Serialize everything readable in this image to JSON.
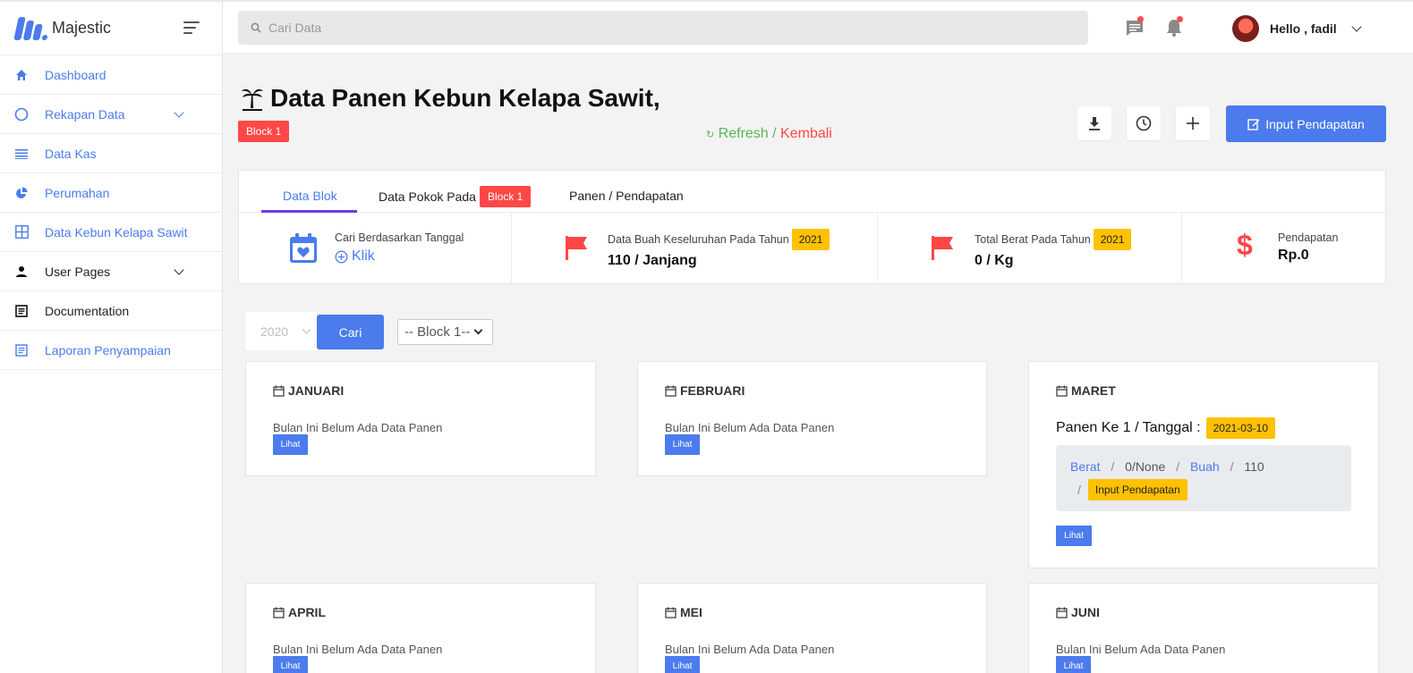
{
  "app": {
    "name": "Majestic",
    "accent": "#4b7bec",
    "danger": "#ff4747",
    "warning": "#ffc100"
  },
  "sidebar": {
    "items": [
      {
        "label": "Dashboard",
        "icon": "home-icon"
      },
      {
        "label": "Rekapan Data",
        "icon": "circle-icon",
        "expandable": true
      },
      {
        "label": "Data Kas",
        "icon": "list-icon"
      },
      {
        "label": "Perumahan",
        "icon": "pie-chart-icon"
      },
      {
        "label": "Data Kebun Kelapa Sawit",
        "icon": "grid-icon"
      },
      {
        "label": "User Pages",
        "icon": "user-icon",
        "expandable": true
      },
      {
        "label": "Documentation",
        "icon": "document-icon"
      },
      {
        "label": "Laporan Penyampaian",
        "icon": "report-icon"
      }
    ]
  },
  "topbar": {
    "search_placeholder": "Cari Data",
    "user_greeting": "Hello , fadil"
  },
  "header": {
    "title": "Data Panen Kebun Kelapa Sawit,",
    "block_badge": "Block 1",
    "refresh_label": "Refresh",
    "separator": " / ",
    "back_label": "Kembali",
    "input_button": "Input Pendapatan"
  },
  "tabs": [
    {
      "label": "Data Blok",
      "active": true
    },
    {
      "label": "Data Pokok Pada",
      "badge": "Block 1"
    },
    {
      "label": "Panen / Pendapatan"
    }
  ],
  "stats": {
    "date_search": {
      "label": "Cari Berdasarkan Tanggal",
      "action": "Klik"
    },
    "fruit": {
      "label": "Data Buah Keseluruhan Pada Tahun",
      "year": "2021",
      "value": "110 / Janjang"
    },
    "weight": {
      "label": "Total Berat Pada Tahun",
      "year": "2021",
      "value": "0 / Kg"
    },
    "income": {
      "label": "Pendapatan",
      "value": "Rp.0"
    }
  },
  "filter": {
    "year": "2020",
    "search_button": "Cari",
    "block_select": "-- Block 1--"
  },
  "months": [
    {
      "name": "JANUARI",
      "empty_text": "Bulan Ini Belum Ada Data Panen",
      "button": "Lihat"
    },
    {
      "name": "FEBRUARI",
      "empty_text": "Bulan Ini Belum Ada Data Panen",
      "button": "Lihat"
    },
    {
      "name": "MARET",
      "panen_label": "Panen Ke 1 / Tanggal :",
      "panen_date": "2021-03-10",
      "berat_label": "Berat",
      "berat_value": "0/None",
      "buah_label": "Buah",
      "buah_value": "110",
      "slash": "/",
      "input_label": "Input Pendapatan",
      "button": "Lihat"
    },
    {
      "name": "APRIL",
      "empty_text": "Bulan Ini Belum Ada Data Panen",
      "button": "Lihat"
    },
    {
      "name": "MEI",
      "empty_text": "Bulan Ini Belum Ada Data Panen",
      "button": "Lihat"
    },
    {
      "name": "JUNI",
      "empty_text": "Bulan Ini Belum Ada Data Panen",
      "button": "Lihat"
    }
  ]
}
